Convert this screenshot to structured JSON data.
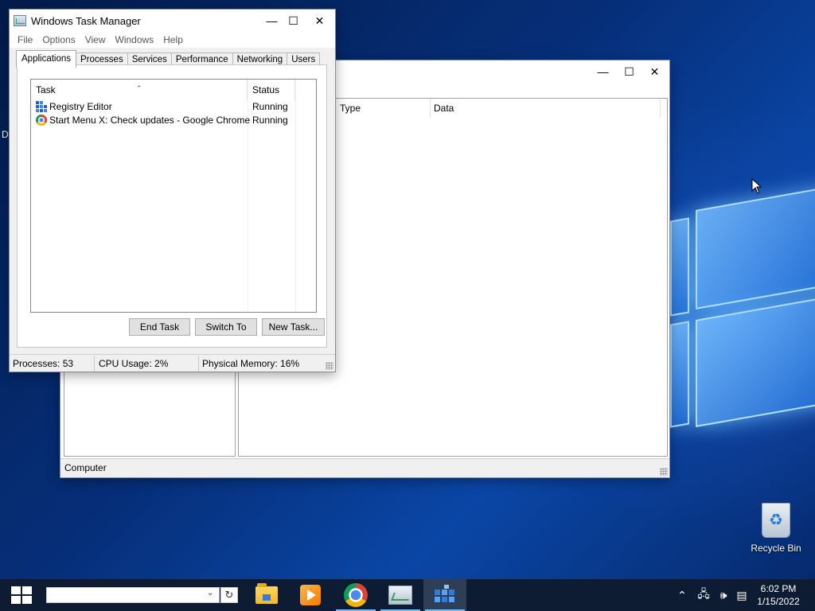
{
  "desktop": {
    "edge_label": "D",
    "recycle_bin_label": "Recycle Bin"
  },
  "regedit": {
    "columns": [
      "Type",
      "Data"
    ],
    "status_text": "Computer"
  },
  "taskmgr": {
    "title": "Windows Task Manager",
    "menu": [
      "File",
      "Options",
      "View",
      "Windows",
      "Help"
    ],
    "tabs": [
      "Applications",
      "Processes",
      "Services",
      "Performance",
      "Networking",
      "Users"
    ],
    "active_tab": "Applications",
    "list": {
      "headers": [
        "Task",
        "Status"
      ],
      "rows": [
        {
          "task": "Registry Editor",
          "status": "Running",
          "icon": "registry-editor-icon"
        },
        {
          "task": "Start Menu X: Check updates - Google Chrome",
          "status": "Running",
          "icon": "chrome-icon"
        }
      ]
    },
    "buttons": {
      "end_task": "End Task",
      "switch_to": "Switch To",
      "new_task": "New Task..."
    },
    "status": {
      "processes": "Processes: 53",
      "cpu": "CPU Usage: 2%",
      "memory": "Physical Memory: 16%"
    }
  },
  "taskbar": {
    "search_value": "",
    "apps": [
      "file-explorer-icon",
      "media-player-icon",
      "chrome-icon",
      "task-manager-icon",
      "registry-editor-icon"
    ],
    "active_app": "registry-editor-icon",
    "clock_time": "6:02 PM",
    "clock_date": "1/15/2022"
  },
  "colors": {
    "taskbar": "#0e1c33",
    "active_underline": "#76b9ed",
    "desktop_blue": "#0a46a6"
  }
}
